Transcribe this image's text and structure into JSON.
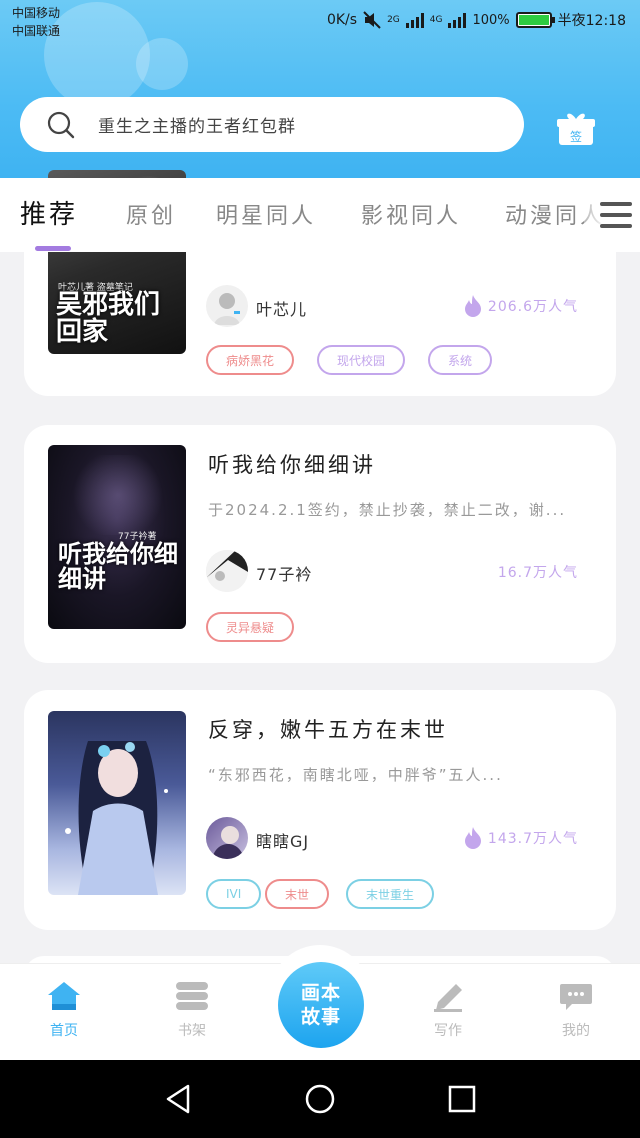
{
  "status_bar": {
    "carrier1": "中国移动",
    "carrier2": "中国联通",
    "speed": "0K/s",
    "net1": "2G",
    "net2": "4G",
    "battery": "100%",
    "time": "半夜12:18"
  },
  "search": {
    "placeholder": "重生之主播的王者红包群"
  },
  "gift": {
    "label": "签",
    "icon": "gift-icon"
  },
  "tabs": [
    {
      "label": "推荐",
      "active": true
    },
    {
      "label": "原创"
    },
    {
      "label": "明星同人"
    },
    {
      "label": "影视同人"
    },
    {
      "label": "动漫同人"
    }
  ],
  "cards": [
    {
      "cover_title": "吴邪我们回家",
      "cover_sub": "叶芯儿著 盗墓笔记",
      "author": "叶芯儿",
      "popularity": "206.6万人气",
      "tags": [
        {
          "label": "病娇黑花",
          "color": "#ee8c8c"
        },
        {
          "label": "现代校园",
          "color": "#c3a6ec"
        },
        {
          "label": "系统",
          "color": "#c3a6ec"
        }
      ]
    },
    {
      "cover_title": "听我给你细细讲",
      "cover_sub": "77子衿著",
      "title": "听我给你细细讲",
      "desc": "于2024.2.1签约，禁止抄袭，禁止二改，谢...",
      "author": "77子衿",
      "popularity": "16.7万人气",
      "tags": [
        {
          "label": "灵异悬疑",
          "color": "#ee8c8c"
        }
      ]
    },
    {
      "title": "反穿，嫩牛五方在末世",
      "desc": "“东邪西花，南瞎北哑，中胖爷”五人...",
      "author": "瞎瞎GJ",
      "popularity": "143.7万人气",
      "tags": [
        {
          "label": "IVI",
          "color": "#7cd0e4"
        },
        {
          "label": "末世",
          "color": "#ee8c8c"
        },
        {
          "label": "末世重生",
          "color": "#7cd0e4"
        }
      ]
    }
  ],
  "bottom_nav": {
    "home": "首页",
    "shelf": "书架",
    "center": "画本故事",
    "write": "写作",
    "mine": "我的"
  },
  "colors": {
    "accent": "#3fb3f2",
    "tab_indicator": "#a37be0",
    "popularity": "#c3a6ec"
  }
}
